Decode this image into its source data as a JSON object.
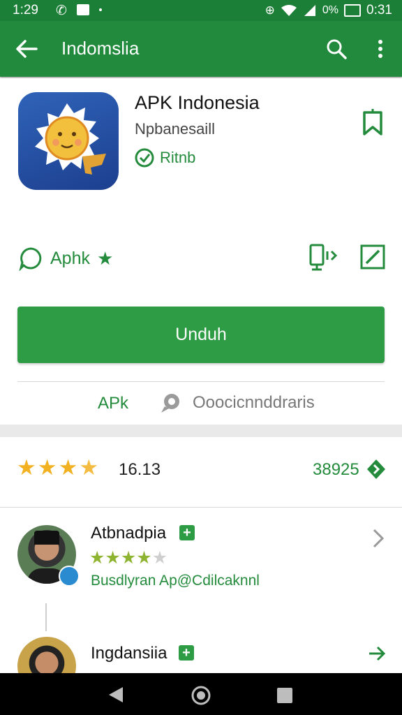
{
  "status_bar": {
    "time": "1:29",
    "battery_text": "0%",
    "clock_right": "0:31"
  },
  "app_bar": {
    "title": "Indomslia"
  },
  "app_info": {
    "name": "APK Indonesia",
    "developer": "Npbanesaill",
    "category_label": "Ritnb",
    "rating_label": "Aphk",
    "install_button": "Unduh",
    "bottom_tab_left": "APk",
    "bottom_tab_right": "Ooocicnnddraris"
  },
  "ratings": {
    "score": "16.13",
    "count": "38925"
  },
  "reviews": [
    {
      "name": "Atbnadpia",
      "text": "Busdlyran Ap@Cdilcaknnl"
    },
    {
      "name": "Ingdansiia"
    }
  ],
  "colors": {
    "primary": "#218a3c",
    "status": "#1b7f37",
    "star": "#f2b120"
  }
}
